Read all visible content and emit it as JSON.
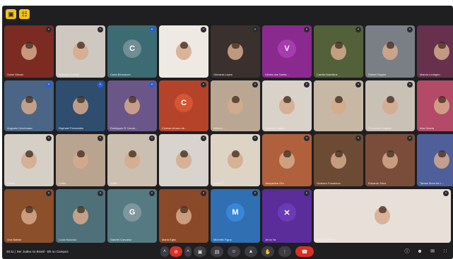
{
  "toolbar": {
    "left_icon_1": "layout-icon",
    "left_icon_2": "grid-icon"
  },
  "tiles": [
    {
      "name": "Solon Micuin",
      "initial": "",
      "bg": "#7b2b22",
      "badge": "red"
    },
    {
      "name": "Reinaldo Nozaki",
      "initial": "",
      "bg": "#cfc8c1",
      "badge": "dark"
    },
    {
      "name": "Carla Bennanch",
      "initial": "C",
      "bg": "#3d6b73",
      "avatar": "#6f8f95",
      "badge": "blue"
    },
    {
      "name": "Nosani",
      "initial": "",
      "bg": "#efe9e4",
      "badge": "dark"
    },
    {
      "name": "Giovana Lopes",
      "initial": "",
      "bg": "#3a302d",
      "badge": "dark"
    },
    {
      "name": "Vitoria dos Santo...",
      "initial": "V",
      "bg": "#8b2a8e",
      "avatar": "#a63cb0",
      "badge": "dark"
    },
    {
      "name": "Camila Mamiltus",
      "initial": "",
      "bg": "#52613a",
      "badge": "dark"
    },
    {
      "name": "Rafael Fagani",
      "initial": "",
      "bg": "#7a7f86",
      "badge": "dark"
    },
    {
      "name": "Marcia Lenhgen",
      "initial": "",
      "bg": "#67304d",
      "badge": "dark"
    },
    {
      "name": "Augusta Cerchmann",
      "initial": "",
      "bg": "#4a6585",
      "badge": "blue"
    },
    {
      "name": "Raphael Fernandes",
      "initial": "",
      "bg": "#2e4d6f",
      "badge": "blue"
    },
    {
      "name": "Rodrigues R Carval...",
      "initial": "",
      "bg": "#6a5688",
      "badge": "blue"
    },
    {
      "name": "Ciceran Amaro de...",
      "initial": "C",
      "bg": "#b5432a",
      "avatar": "#d65533",
      "badge": "dark"
    },
    {
      "name": "Alfredo...",
      "initial": "",
      "bg": "#b9a793",
      "badge": "dark"
    },
    {
      "name": "Daniela Cuppes",
      "initial": "",
      "bg": "#d9d2c9",
      "badge": "dark"
    },
    {
      "name": "",
      "initial": "",
      "bg": "#c7b8a5",
      "badge": "dark"
    },
    {
      "name": "Fernanda Gagliani",
      "initial": "",
      "bg": "#c9c1b6",
      "badge": "dark"
    },
    {
      "name": "Ana Garcia",
      "initial": "",
      "bg": "#b24a68",
      "badge": "dark"
    },
    {
      "name": "Flavia",
      "initial": "",
      "bg": "#d6cfc6",
      "badge": "dark"
    },
    {
      "name": "Cintia",
      "initial": "",
      "bg": "#b8a48f",
      "badge": "dark"
    },
    {
      "name": "Katia...",
      "initial": "",
      "bg": "#cbbfb1",
      "badge": "dark"
    },
    {
      "name": "",
      "initial": "",
      "bg": "#d8d3cd",
      "badge": "dark"
    },
    {
      "name": "Jonas F...",
      "initial": "",
      "bg": "#ddd4c6",
      "badge": "dark"
    },
    {
      "name": "Jacqueline Ors",
      "initial": "",
      "bg": "#b0603c",
      "badge": "dark"
    },
    {
      "name": "Gustavo Fonsenca",
      "initial": "",
      "bg": "#6d4a33",
      "badge": "dark"
    },
    {
      "name": "Eduardo Silva",
      "initial": "",
      "bg": "#7a4d3a",
      "badge": "dark"
    },
    {
      "name": "Tamila Sinet da L...",
      "initial": "",
      "bg": "#4f5f99",
      "badge": "blue"
    },
    {
      "name": "Ana Batista",
      "initial": "",
      "bg": "#8b4f2c",
      "badge": "dark"
    },
    {
      "name": "Lucia Nocchio",
      "initial": "",
      "bg": "#4d7079",
      "badge": "dark"
    },
    {
      "name": "Gabriel Carvalho",
      "initial": "G",
      "bg": "#557a82",
      "avatar": "#7d979c",
      "badge": "dark"
    },
    {
      "name": "Maria Egito",
      "initial": "",
      "bg": "#8a4a29",
      "badge": "dark"
    },
    {
      "name": "Michelle Figuo",
      "initial": "M",
      "bg": "#2f6fb2",
      "avatar": "#3a86d6",
      "badge": "dark"
    },
    {
      "name": "Jel ta Ya",
      "initial": "✕",
      "bg": "#5a2d9a",
      "avatar": "#6a3bb5",
      "badge": "dark"
    },
    {
      "name": "Carolina Nefan",
      "initial": "",
      "bg": "#e8e0d8",
      "badge": "dark"
    }
  ],
  "bottom": {
    "meeting_info": "20:11 | Ser Judeu no Brasil - Bh no Campus"
  },
  "controls": [
    {
      "icon": "chevron-up-icon",
      "glyph": "˄"
    },
    {
      "icon": "mic-off-icon",
      "glyph": "⊘"
    },
    {
      "icon": "chevron-up-icon",
      "glyph": "˄"
    },
    {
      "icon": "camera-icon",
      "glyph": "▣"
    },
    {
      "icon": "captions-icon",
      "glyph": "▤"
    },
    {
      "icon": "emoji-icon",
      "glyph": "☺"
    },
    {
      "icon": "present-icon",
      "glyph": "▲"
    },
    {
      "icon": "raise-hand-icon",
      "glyph": "✋"
    },
    {
      "icon": "more-icon",
      "glyph": "⋮"
    },
    {
      "icon": "end-call-icon",
      "glyph": "☎"
    }
  ],
  "right_controls": [
    {
      "icon": "info-icon",
      "glyph": "ⓘ"
    },
    {
      "icon": "people-icon",
      "glyph": "☻"
    },
    {
      "icon": "chat-icon",
      "glyph": "✉"
    },
    {
      "icon": "activities-icon",
      "glyph": "∷"
    }
  ]
}
